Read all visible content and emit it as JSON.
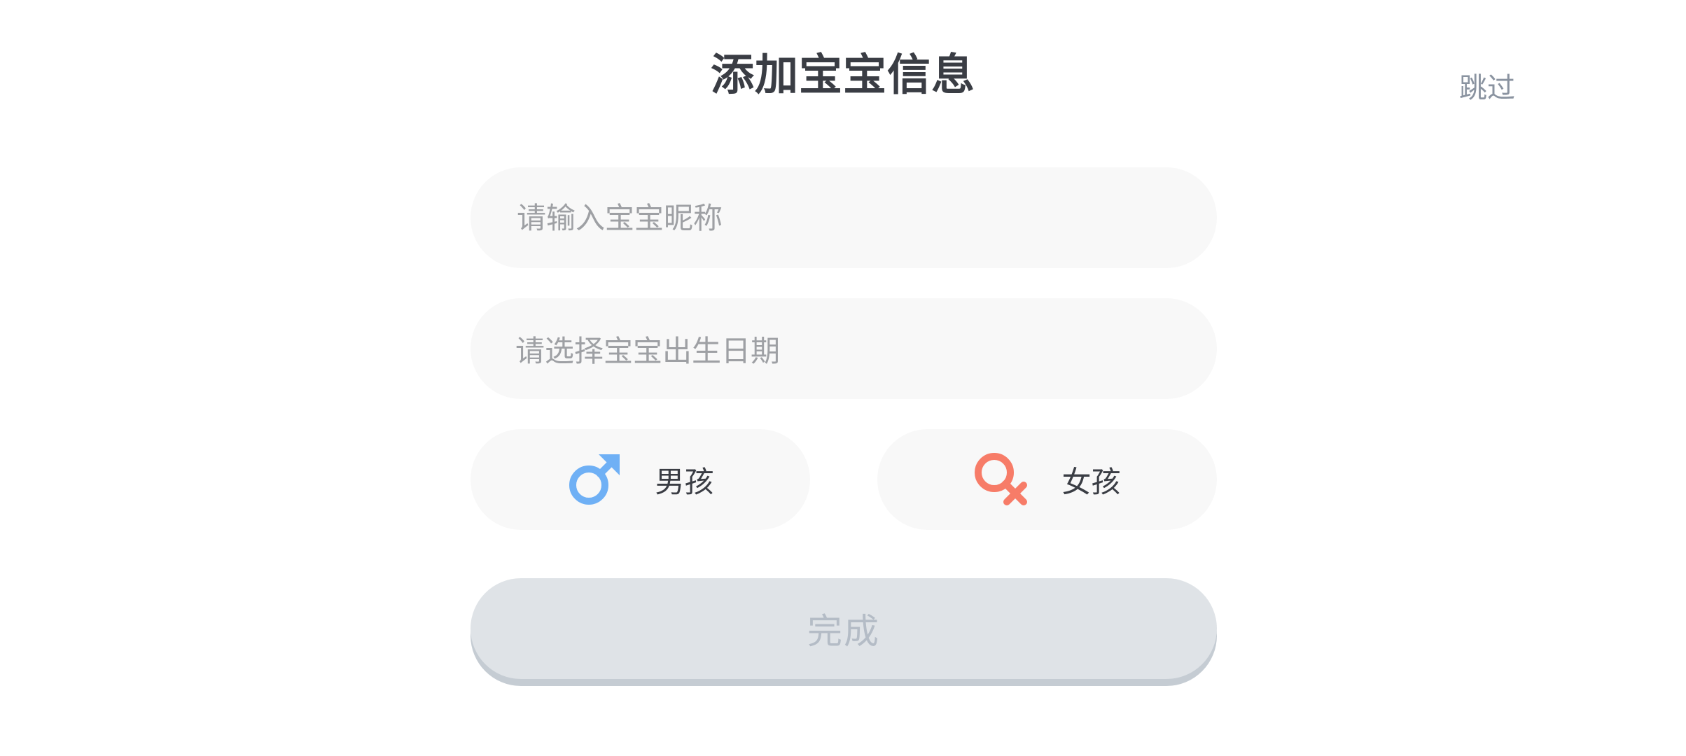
{
  "header": {
    "title": "添加宝宝信息",
    "skip_label": "跳过"
  },
  "form": {
    "nickname": {
      "placeholder": "请输入宝宝昵称",
      "value": ""
    },
    "birthday": {
      "placeholder": "请选择宝宝出生日期"
    },
    "gender": {
      "options": [
        {
          "label": "男孩",
          "icon": "male-symbol-icon",
          "color": "#6fb0f5"
        },
        {
          "label": "女孩",
          "icon": "female-symbol-icon",
          "color": "#f77c68"
        }
      ]
    },
    "submit_label": "完成"
  },
  "colors": {
    "field_background": "#f8f8f8",
    "title_text": "#3a3d44",
    "placeholder_text": "#9ea0a4",
    "skip_text": "#8a93a0",
    "submit_disabled_bg": "#dfe3e7",
    "submit_disabled_text": "#b4bcc6"
  }
}
